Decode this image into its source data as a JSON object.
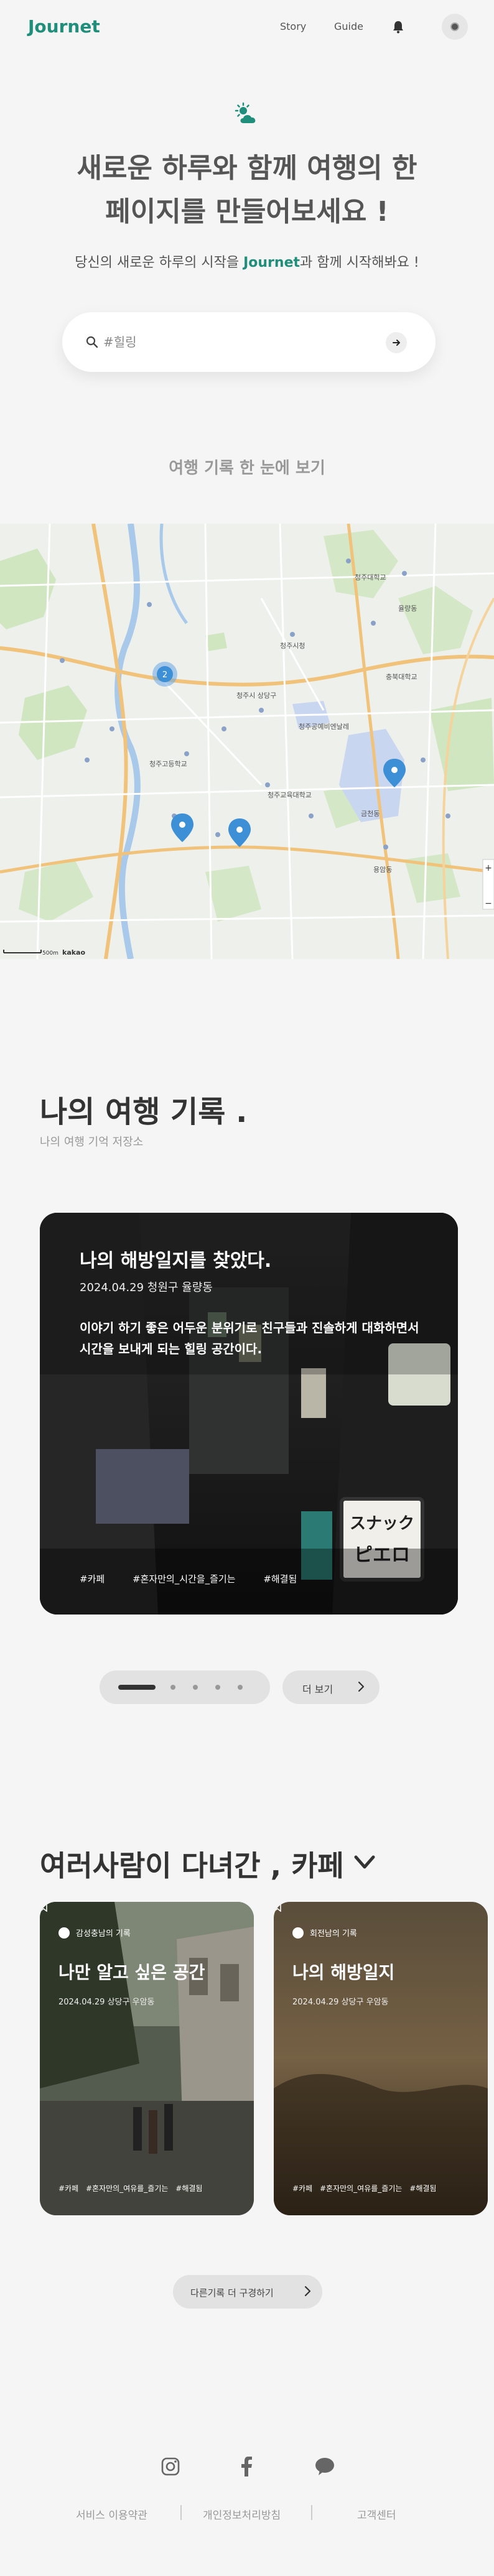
{
  "header": {
    "logo": "Journet",
    "nav": [
      "Story",
      "Guide"
    ]
  },
  "hero": {
    "title_line1": "새로운 하루와 함께 여행의 한",
    "title_line2": "페이지를 만들어보세요 !",
    "sub_before": "당신의 새로운 하루의 시작을 ",
    "sub_brand": "Journet",
    "sub_after": "과 함께 시작해봐요 !"
  },
  "search": {
    "placeholder": "#힐링"
  },
  "map_section": {
    "label": "여행 기록 한 눈에 보기",
    "cluster_count": "2",
    "labels": [
      "청주시청",
      "청주대학교",
      "충북대학교",
      "청주시 상당구",
      "청주공예비엔날레",
      "청주고등학교",
      "청주교육대학교",
      "용암동",
      "율량동",
      "금천동"
    ],
    "scale": "500m",
    "provider": "kakao"
  },
  "my_travel": {
    "title": "나의 여행 기록 .",
    "subtitle": "나의 여행 기억 저장소",
    "card": {
      "title": "나의 해방일지를 찾았다.",
      "date": "2024.04.29 청원구 율량동",
      "description": "이야기 하기 좋은 어두운 분위기로 친구들과 진솔하게 대화하면서 시간을 보내게 되는 힐링 공간이다.",
      "tags": [
        "#카페",
        "#혼자만의_시간을_즐기는",
        "#해결됨"
      ],
      "signs": [
        "スナック",
        "ピエロ"
      ]
    },
    "more_label": "더 보기"
  },
  "cafe_section": {
    "title": "여러사람이 다녀간 , 카페",
    "cards": [
      {
        "user": "감성충남의 기록",
        "title": "나만 알고 싶은 공간",
        "date": "2024.04.29 상당구 우암동",
        "tags": [
          "#카페",
          "#혼자만의_여유를_즐기는",
          "#해결됨"
        ]
      },
      {
        "user": "회전남의 기록",
        "title": "나의 해방일지",
        "date": "2024.04.29 상당구 우암동",
        "tags": [
          "#카페",
          "#혼자만의_여유를_즐기는",
          "#해결됨"
        ]
      }
    ],
    "more_label": "다른기록 더 구경하기"
  },
  "footer": {
    "links": [
      "서비스 이용약관",
      "개인정보처리방침",
      "고객센터"
    ]
  },
  "colors": {
    "brand": "#1f8f7b",
    "background": "#f5f5f5",
    "marker": "#3d8fd6"
  }
}
